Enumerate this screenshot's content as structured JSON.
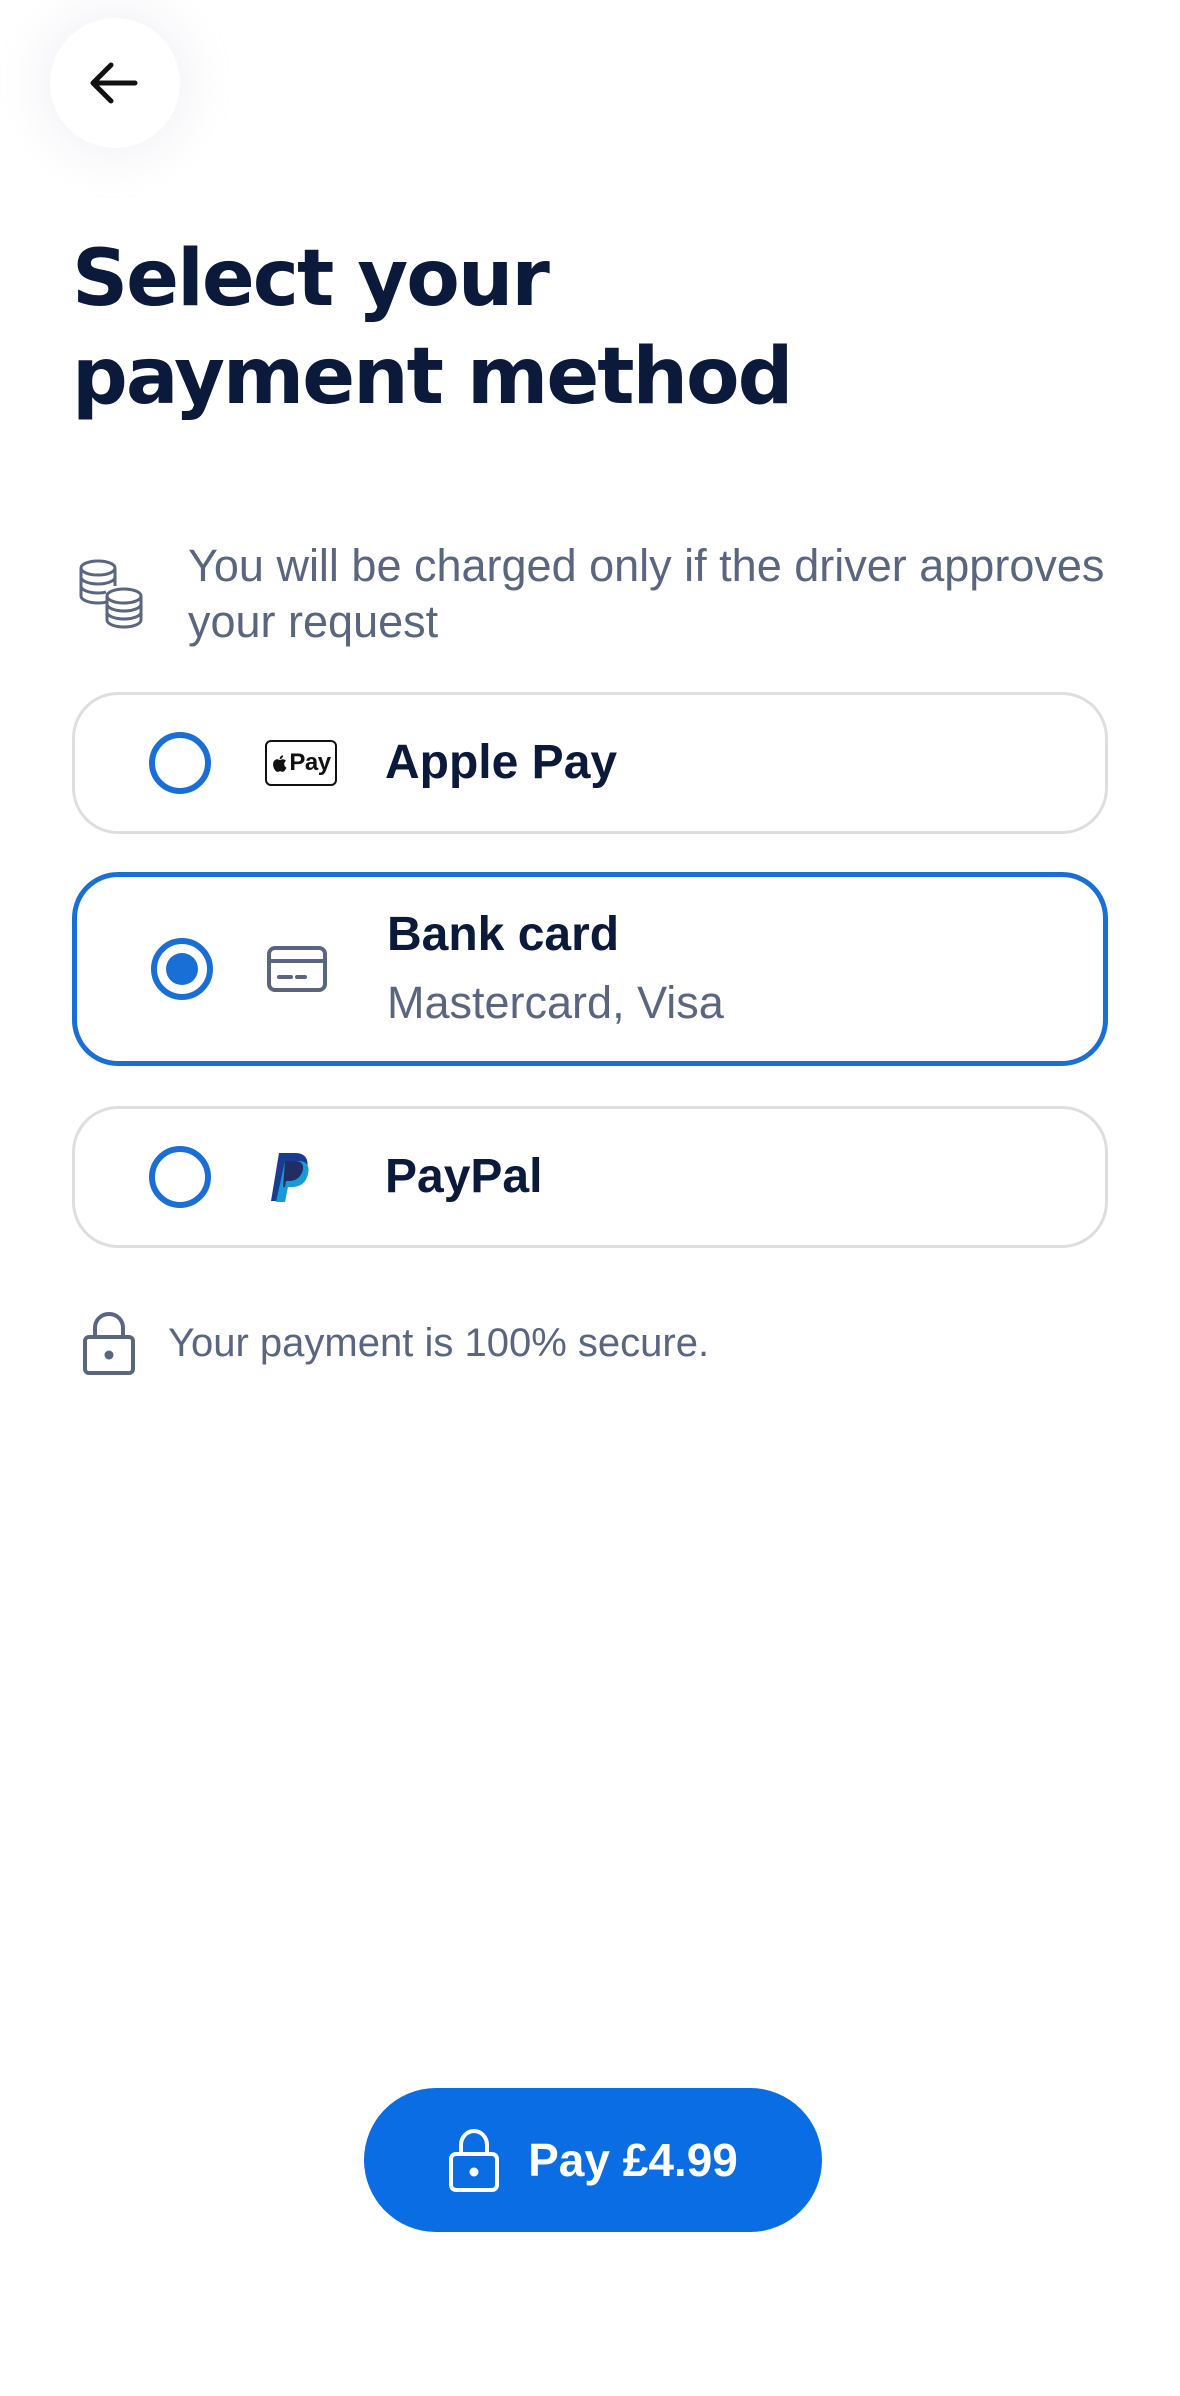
{
  "header": {
    "back_icon": "arrow-left-icon"
  },
  "title": {
    "line1": "Select your",
    "line2": "payment method"
  },
  "notice": {
    "icon": "coins-icon",
    "text": "You will be charged only if the driver approves your request"
  },
  "payment_options": [
    {
      "label": "Apple Pay",
      "logo_text": "Pay",
      "selected": false,
      "icon": "apple-pay-logo"
    },
    {
      "label": "Bank card",
      "sublabel": "Mastercard, Visa",
      "selected": true,
      "icon": "credit-card-icon"
    },
    {
      "label": "PayPal",
      "selected": false,
      "icon": "paypal-logo"
    }
  ],
  "secure": {
    "icon": "lock-icon",
    "text": "Your payment is 100% secure."
  },
  "pay_button": {
    "icon": "lock-icon",
    "label": "Pay £4.99"
  },
  "colors": {
    "accent": "#1a6fd6",
    "button": "#0b6de3",
    "title": "#0b1a3a",
    "muted": "#5a6680",
    "border": "#dedede"
  }
}
